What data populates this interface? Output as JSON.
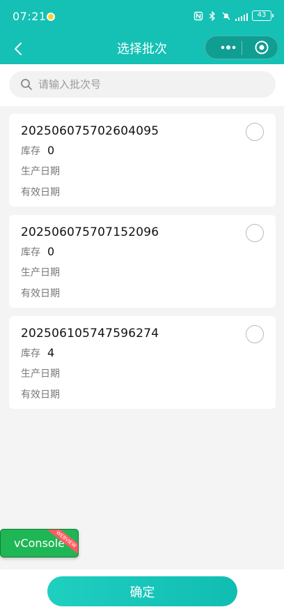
{
  "status_bar": {
    "time": "07:21",
    "battery": "43"
  },
  "nav": {
    "title": "选择批次"
  },
  "search": {
    "placeholder": "请输入批次号"
  },
  "labels": {
    "stock": "库存",
    "production_date": "生产日期",
    "expiry_date": "有效日期"
  },
  "batches": [
    {
      "batch_no": "202506075702604095",
      "stock": "0"
    },
    {
      "batch_no": "202506075707152096",
      "stock": "0"
    },
    {
      "batch_no": "202506105747596274",
      "stock": "4"
    }
  ],
  "vconsole": {
    "label": "vConsole",
    "ribbon": "WEBVIEW"
  },
  "footer": {
    "confirm_label": "确定"
  },
  "colors": {
    "primary": "#14c1b4",
    "vconsole_green": "#1fb655",
    "ribbon_red": "#ff5a5f"
  }
}
